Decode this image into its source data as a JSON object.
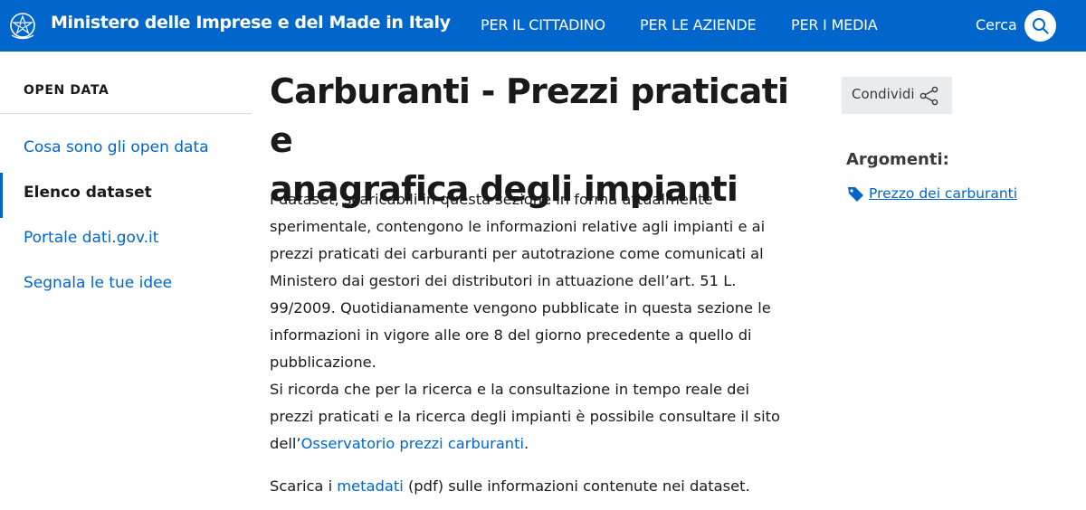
{
  "header": {
    "site_title": "Ministero delle Imprese e del Made in Italy",
    "nav": [
      {
        "label": "PER IL CITTADINO"
      },
      {
        "label": "PER LE AZIENDE"
      },
      {
        "label": "PER I MEDIA"
      }
    ],
    "search_label": "Cerca",
    "search_icon": "search-icon",
    "emblem_icon": "republic-emblem-icon"
  },
  "sidebar": {
    "heading": "OPEN DATA",
    "items": [
      {
        "label": "Cosa sono gli open data",
        "active": false
      },
      {
        "label": "Elenco dataset",
        "active": true
      },
      {
        "label": "Portale dati.gov.it",
        "active": false
      },
      {
        "label": "Segnala le tue idee",
        "active": false
      }
    ]
  },
  "main": {
    "title_line1": "Carburanti - Prezzi praticati e",
    "title_line2": "anagrafica degli impianti",
    "paragraph": {
      "text": "I dataset, scaricabili in questa sezione in forma attualmente sperimentale, contengono le informazioni relative agli impianti e ai prezzi praticati dei carburanti per autotrazione come comunicati al Ministero dai gestori dei distributori in attuazione dell’art. 51 L. 99/2009. Quotidianamente vengono pubblicate in questa sezione le informazioni in vigore alle ore 8 del giorno precedente a quello di pubblicazione.",
      "text2": "Si ricorda che per la ricerca e la consultazione in tempo reale dei prezzi praticati e la ricerca degli impianti è possibile consultare il sito dell’",
      "link": "Osservatorio prezzi carburanti",
      "end": "."
    },
    "metadata": {
      "before": "Scarica i ",
      "link": "metadati",
      "after": " (pdf) sulle informazioni contenute nei dataset."
    }
  },
  "aside": {
    "share_label": "Condividi",
    "share_icon": "share-icon",
    "topics_title": "Argomenti:",
    "topic_icon": "tag-icon",
    "topic_link": "Prezzo dei carburanti"
  },
  "colors": {
    "brand_blue": "#0066cc",
    "text_dark": "#1a1a1a",
    "share_bg": "#e9ecef"
  }
}
